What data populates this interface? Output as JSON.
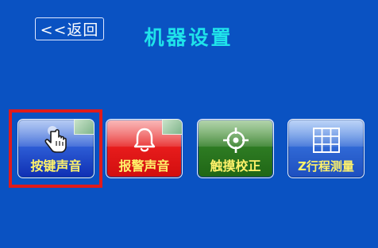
{
  "header": {
    "back_label": "<<返回",
    "title": "机器设置"
  },
  "menu": {
    "items": [
      {
        "label": "按键声音",
        "icon": "hand-pointer-icon"
      },
      {
        "label": "报警声音",
        "icon": "bell-icon"
      },
      {
        "label": "触摸校正",
        "icon": "crosshair-icon"
      },
      {
        "label": "Z行程测量",
        "icon": "grid-icon"
      }
    ],
    "selected_index": 0
  },
  "colors": {
    "background": "#0a52c2",
    "title": "#1fe3ea",
    "tile_label": "#fff26a",
    "selection": "#e01b1b"
  }
}
